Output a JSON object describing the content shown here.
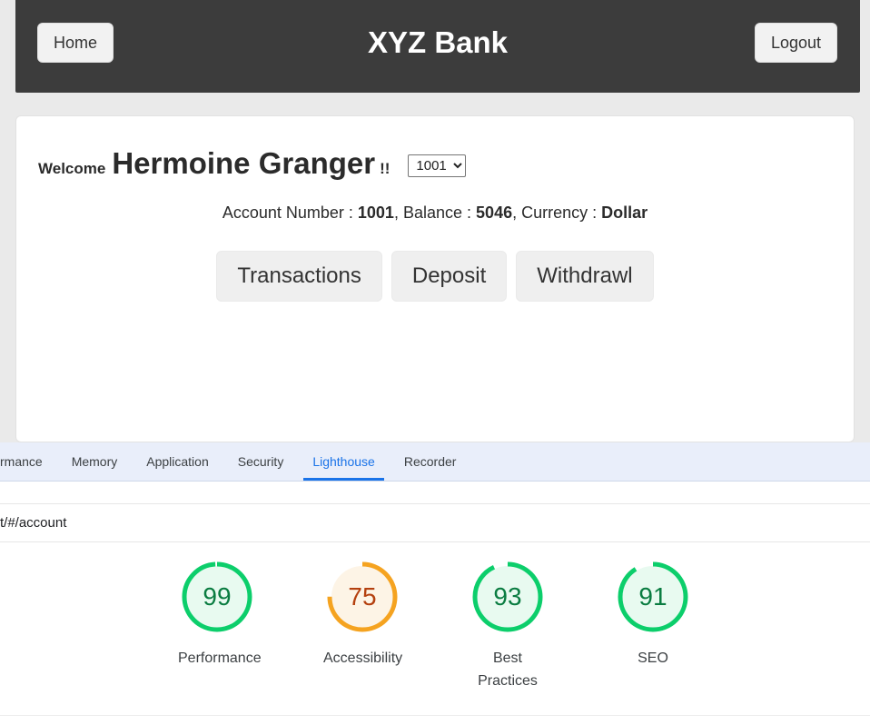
{
  "navbar": {
    "home_label": "Home",
    "brand_title": "XYZ Bank",
    "logout_label": "Logout"
  },
  "account_panel": {
    "welcome_label": "Welcome",
    "customer_name": "Hermoine Granger",
    "exclamation": "!!",
    "account_select": {
      "selected": "1001",
      "options": [
        "1001"
      ]
    },
    "info": {
      "account_number_label": "Account Number :",
      "account_number_value": "1001",
      "separator_1": ",",
      "balance_label": "Balance :",
      "balance_value": "5046",
      "separator_2": ",",
      "currency_label": "Currency :",
      "currency_value": "Dollar"
    },
    "actions": [
      {
        "label": "Transactions"
      },
      {
        "label": "Deposit"
      },
      {
        "label": "Withdrawl"
      }
    ]
  },
  "devtools": {
    "tabs": [
      {
        "label": "rmance",
        "active": false
      },
      {
        "label": "Memory",
        "active": false
      },
      {
        "label": "Application",
        "active": false
      },
      {
        "label": "Security",
        "active": false
      },
      {
        "label": "Lighthouse",
        "active": true
      },
      {
        "label": "Recorder",
        "active": false
      }
    ],
    "url": "t/#/account",
    "active_tab_color": "#1a73e8"
  },
  "lighthouse": {
    "gauges": [
      {
        "label": "Performance",
        "score": "99",
        "pct": 99,
        "color": "#0cce6b",
        "track": "#e8faf0",
        "text_color": "#0a7c41"
      },
      {
        "label": "Accessibility",
        "score": "75",
        "pct": 75,
        "color": "#f5a320",
        "track": "#fdf4e6",
        "text_color": "#b4400f"
      },
      {
        "label": "Best Practices",
        "score": "93",
        "pct": 93,
        "color": "#0cce6b",
        "track": "#e8faf0",
        "text_color": "#0a7c41"
      },
      {
        "label": "SEO",
        "score": "91",
        "pct": 91,
        "color": "#0cce6b",
        "track": "#e8faf0",
        "text_color": "#0a7c41"
      }
    ]
  }
}
